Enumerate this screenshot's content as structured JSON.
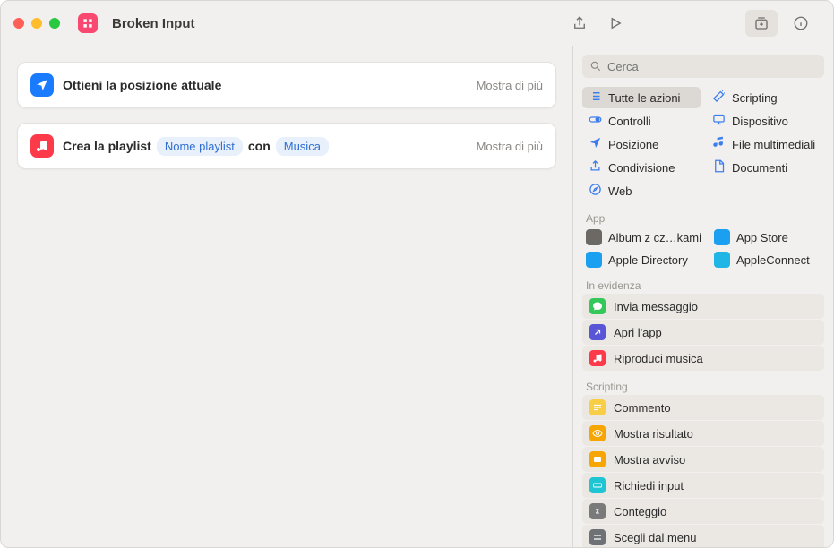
{
  "window": {
    "title": "Broken Input"
  },
  "actions": [
    {
      "icon": "location",
      "iconBg": "#1a7bff",
      "parts": [
        {
          "t": "bold",
          "v": "Ottieni la posizione attuale"
        }
      ],
      "showMore": "Mostra di più"
    },
    {
      "icon": "music",
      "iconBg": "#fc3a4a",
      "parts": [
        {
          "t": "bold",
          "v": "Crea la playlist"
        },
        {
          "t": "token",
          "v": "Nome playlist"
        },
        {
          "t": "bold",
          "v": "con"
        },
        {
          "t": "token",
          "v": "Musica"
        }
      ],
      "showMore": "Mostra di più"
    }
  ],
  "search": {
    "placeholder": "Cerca"
  },
  "categories": [
    {
      "label": "Tutte le azioni",
      "icon": "list",
      "color": "#3b7ded",
      "selected": true
    },
    {
      "label": "Scripting",
      "icon": "wand",
      "color": "#3b7ded"
    },
    {
      "label": "Controlli",
      "icon": "switch",
      "color": "#3b7ded"
    },
    {
      "label": "Dispositivo",
      "icon": "display",
      "color": "#3b7ded"
    },
    {
      "label": "Posizione",
      "icon": "location",
      "color": "#3b7ded"
    },
    {
      "label": "File multimediali",
      "icon": "note",
      "color": "#3b7ded"
    },
    {
      "label": "Condivisione",
      "icon": "share",
      "color": "#3b7ded"
    },
    {
      "label": "Documenti",
      "icon": "doc",
      "color": "#3b7ded"
    },
    {
      "label": "Web",
      "icon": "safari",
      "color": "#3b7ded"
    }
  ],
  "sections": {
    "apps": {
      "header": "App",
      "items": [
        {
          "label": "Album z cz…kami",
          "color": "#6c6864"
        },
        {
          "label": "App Store",
          "color": "#1a9ff1"
        },
        {
          "label": "Apple Directory",
          "color": "#1a9ff1"
        },
        {
          "label": "AppleConnect",
          "color": "#1fb6e6"
        }
      ]
    },
    "featured": {
      "header": "In evidenza",
      "items": [
        {
          "label": "Invia messaggio",
          "bg": "#34c759",
          "icon": "message"
        },
        {
          "label": "Apri l'app",
          "bg": "#5856d6",
          "icon": "open"
        },
        {
          "label": "Riproduci musica",
          "bg": "#fc3a4a",
          "icon": "music"
        }
      ]
    },
    "scripting": {
      "header": "Scripting",
      "items": [
        {
          "label": "Commento",
          "bg": "#f7ce46",
          "icon": "lines"
        },
        {
          "label": "Mostra risultato",
          "bg": "#f7a500",
          "icon": "eye"
        },
        {
          "label": "Mostra avviso",
          "bg": "#f7a500",
          "icon": "alert"
        },
        {
          "label": "Richiedi input",
          "bg": "#20c5d4",
          "icon": "input"
        },
        {
          "label": "Conteggio",
          "bg": "#7a7a7a",
          "icon": "sigma"
        },
        {
          "label": "Scegli dal menu",
          "bg": "#6e7176",
          "icon": "menu"
        }
      ]
    }
  }
}
